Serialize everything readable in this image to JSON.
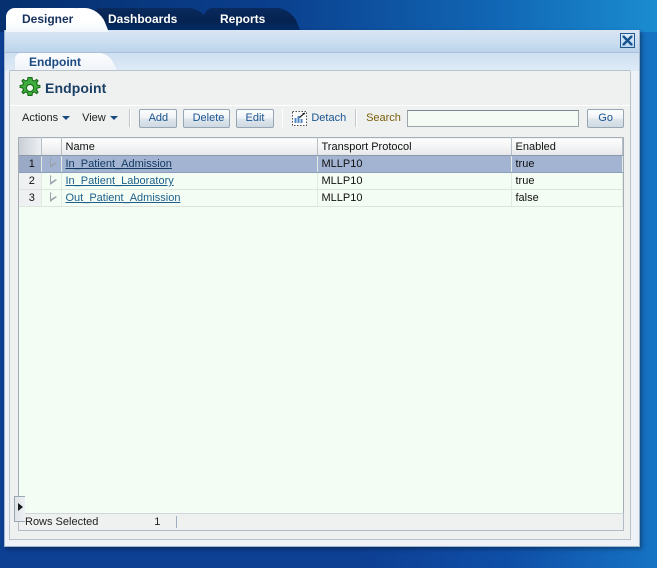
{
  "main_tabs": [
    {
      "label": "Designer",
      "active": true
    },
    {
      "label": "Dashboards",
      "active": false
    },
    {
      "label": "Reports",
      "active": false
    }
  ],
  "window": {
    "close_icon": "close-icon",
    "subtab": {
      "label": "Endpoint"
    }
  },
  "page": {
    "icon": "gear-icon",
    "title": "Endpoint"
  },
  "toolbar": {
    "actions_label": "Actions",
    "view_label": "View",
    "add_label": "Add",
    "delete_label": "Delete",
    "edit_label": "Edit",
    "detach_label": "Detach",
    "detach_icon": "detach-icon",
    "search_label": "Search",
    "search_value": "",
    "search_placeholder": "",
    "go_label": "Go"
  },
  "table": {
    "columns": [
      "",
      "",
      "Name",
      "Transport Protocol",
      "Enabled"
    ],
    "rows": [
      {
        "num": "1",
        "name": "In_Patient_Admission",
        "protocol": "MLLP10",
        "enabled": "true",
        "selected": true
      },
      {
        "num": "2",
        "name": "In_Patient_Laboratory",
        "protocol": "MLLP10",
        "enabled": "true",
        "selected": false
      },
      {
        "num": "3",
        "name": "Out_Patient_Admission",
        "protocol": "MLLP10",
        "enabled": "false",
        "selected": false
      }
    ]
  },
  "status": {
    "rows_selected_label": "Rows Selected",
    "rows_selected_value": "1"
  },
  "colors": {
    "chrome_blue": "#0d3f93",
    "accent_link": "#1d5f8a",
    "selection": "#a3b4d2",
    "grid_bg": "#f4fdf4",
    "search_label": "#7a6008",
    "title": "#1c3f66",
    "gear_green": "#2e9b2e"
  }
}
